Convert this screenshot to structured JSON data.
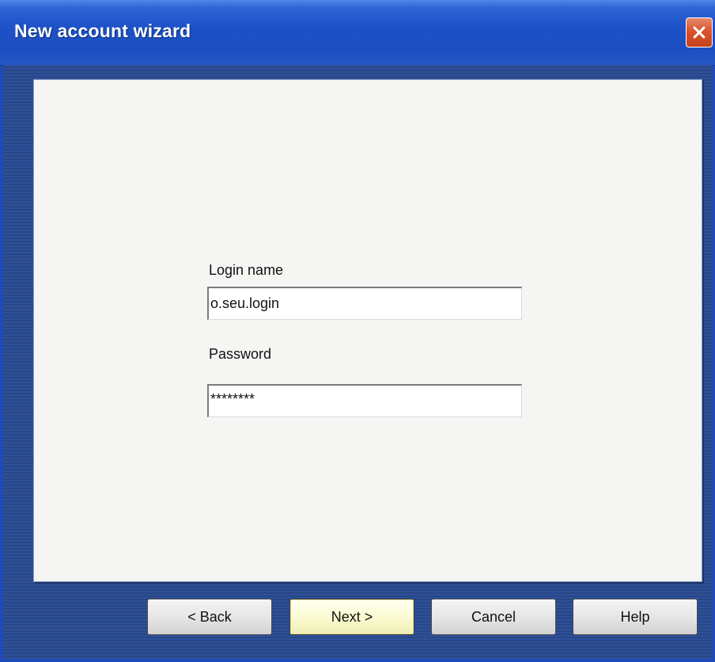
{
  "window": {
    "title": "New account wizard"
  },
  "form": {
    "login_label": "Login name",
    "login_value": "o.seu.login",
    "password_label": "Password",
    "password_value": "********"
  },
  "buttons": {
    "back": "< Back",
    "next": "Next >",
    "cancel": "Cancel",
    "help": "Help"
  },
  "icons": {
    "close": "close-icon"
  },
  "colors": {
    "titlebar": "#1e52c8",
    "close_button": "#d9532c",
    "panel": "#f5f5f3",
    "default_button": "#fafad0"
  }
}
